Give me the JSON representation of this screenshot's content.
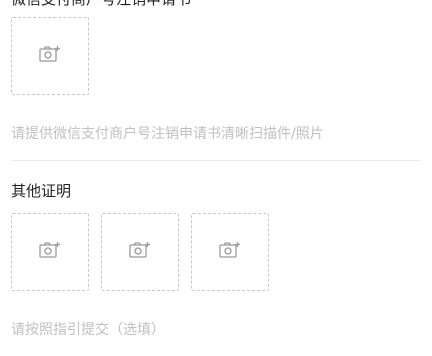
{
  "section1": {
    "title": "微信支付商户号注销申请书",
    "hint": "请提供微信支付商户号注销申请书清晰扫描件/照片",
    "upload_icon": "camera-add-icon"
  },
  "section2": {
    "title": "其他证明",
    "hint": "请按照指引提交（选填）",
    "upload_icon": "camera-add-icon"
  },
  "colors": {
    "hint_text": "#c0c0c0",
    "dashed_border": "#c8c8c8",
    "icon": "#9a9a9a"
  }
}
